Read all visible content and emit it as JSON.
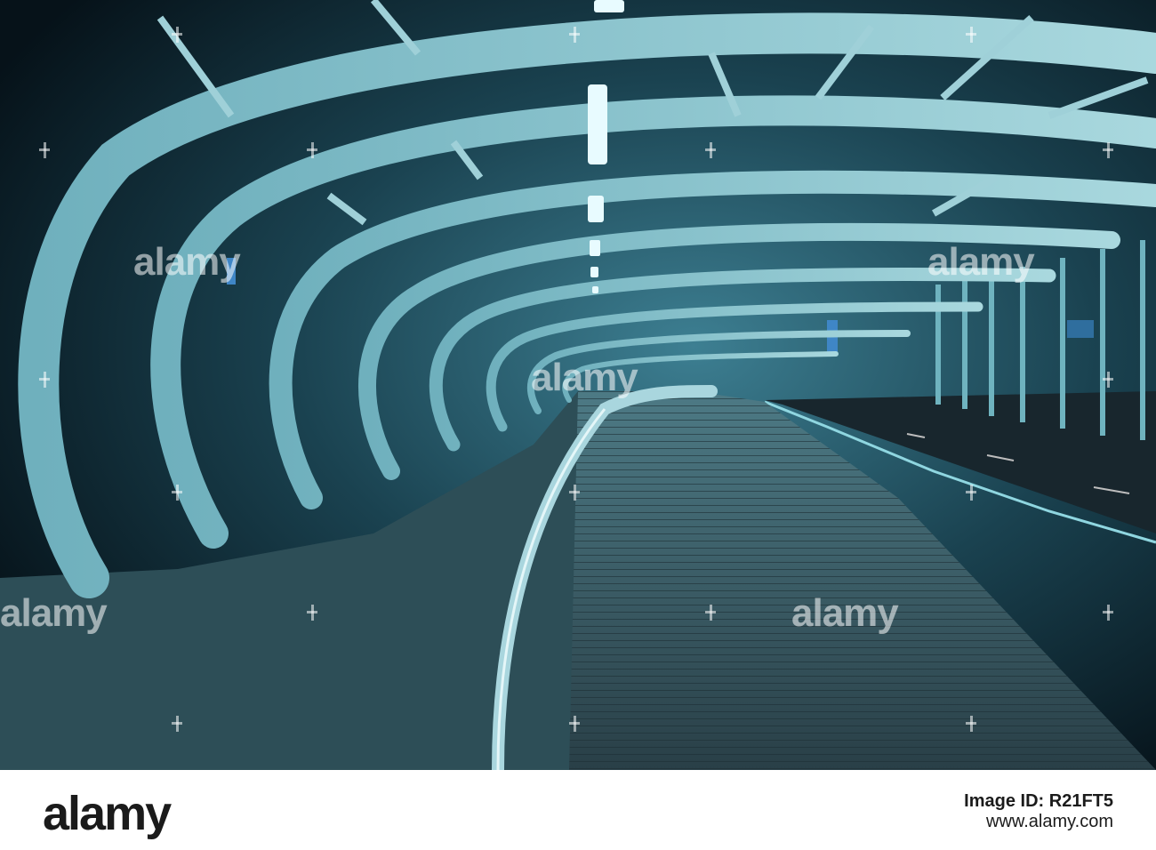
{
  "image": {
    "description_alt": "",
    "watermark_text": "alamy"
  },
  "footer": {
    "logo": "alamy",
    "image_id": "Image ID: R21FT5",
    "url": "www.alamy.com"
  }
}
